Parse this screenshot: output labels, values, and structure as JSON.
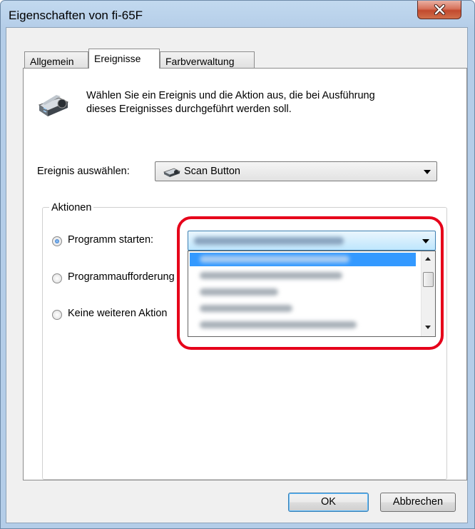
{
  "window": {
    "title": "Eigenschaften von fi-65F"
  },
  "tabs": [
    {
      "label": "Allgemein"
    },
    {
      "label": "Ereignisse"
    },
    {
      "label": "Farbverwaltung"
    }
  ],
  "events_tab": {
    "description_line1": "Wählen Sie ein Ereignis und die Aktion aus, die bei Ausführung",
    "description_line2": "dieses Ereignisses durchgeführt werden soll.",
    "event_label": "Ereignis auswählen:",
    "event_value": "Scan Button",
    "actions_group_label": "Aktionen",
    "radio_start_program": "Programm starten:",
    "radio_prompt": "Programmaufforderung",
    "radio_no_action": "Keine weiteren Aktion"
  },
  "buttons": {
    "ok": "OK",
    "cancel": "Abbrechen"
  },
  "colors": {
    "highlight": "#e6001a",
    "selection": "#3399ff"
  },
  "icons": {
    "scanner": "scanner-icon",
    "scan_button": "scan-button-icon",
    "close": "close-icon"
  }
}
